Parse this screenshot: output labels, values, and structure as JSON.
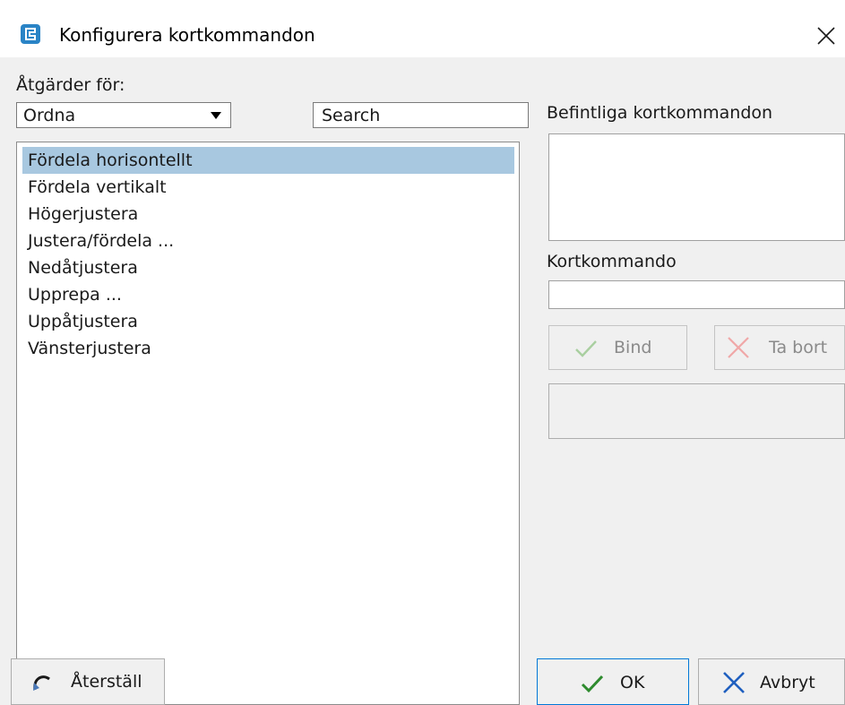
{
  "window": {
    "title": "Konfigurera kortkommandon",
    "icons": {
      "app": "app-logo-icon",
      "close": "close-icon"
    }
  },
  "actions": {
    "label": "Åtgärder för:",
    "category_selected": "Ordna",
    "search_placeholder": "Search",
    "items": [
      {
        "label": "Fördela horisontellt",
        "selected": true
      },
      {
        "label": "Fördela vertikalt",
        "selected": false
      },
      {
        "label": "Högerjustera",
        "selected": false
      },
      {
        "label": "Justera/fördela ...",
        "selected": false
      },
      {
        "label": "Nedåtjustera",
        "selected": false
      },
      {
        "label": "Upprepa ...",
        "selected": false
      },
      {
        "label": "Uppåtjustera",
        "selected": false
      },
      {
        "label": "Vänsterjustera",
        "selected": false
      }
    ]
  },
  "right_panel": {
    "existing_label": "Befintliga kortkommandon",
    "shortcut_label": "Kortkommando",
    "shortcut_value": "",
    "bind_label": "Bind",
    "remove_label": "Ta bort"
  },
  "footer": {
    "reset_label": "Återställ",
    "ok_label": "OK",
    "cancel_label": "Avbryt"
  },
  "colors": {
    "selection": "#a8c8e0",
    "ok_check": "#2e8b2e",
    "cancel_x": "#1f5fbf",
    "disabled_check": "#a9cfa0",
    "disabled_x": "#f0a8a8",
    "app_icon": "#2a84c6"
  }
}
